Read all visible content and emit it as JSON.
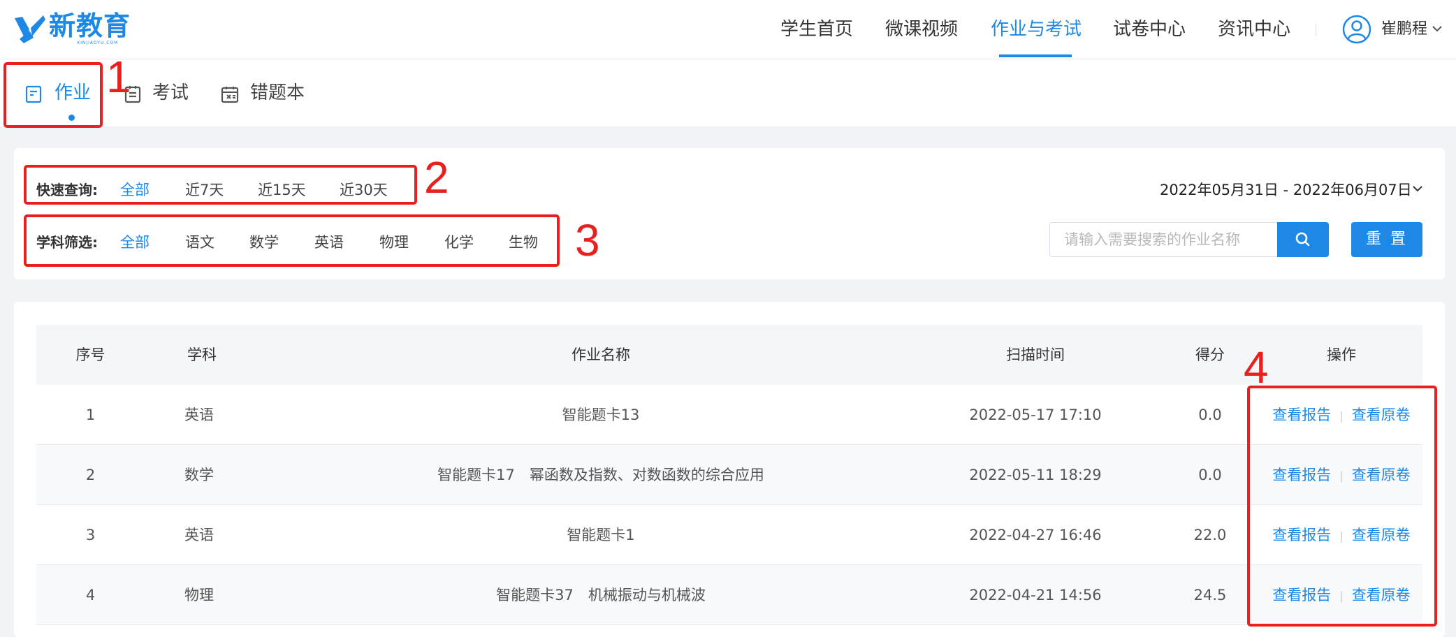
{
  "brand": {
    "name": "新教育",
    "subtitle": "XINJIAOYU.COM",
    "color": "#1e88e5"
  },
  "nav": {
    "items": [
      {
        "label": "学生首页",
        "active": false
      },
      {
        "label": "微课视频",
        "active": false
      },
      {
        "label": "作业与考试",
        "active": true
      },
      {
        "label": "试卷中心",
        "active": false
      },
      {
        "label": "资讯中心",
        "active": false
      }
    ],
    "user": {
      "name": "崔鹏程",
      "icon": "user-circle-icon"
    }
  },
  "subtabs": [
    {
      "label": "作业",
      "icon": "homework-icon",
      "active": true
    },
    {
      "label": "考试",
      "icon": "exam-icon",
      "active": false
    },
    {
      "label": "错题本",
      "icon": "mistake-book-icon",
      "active": false
    }
  ],
  "filters": {
    "quick": {
      "label": "快速查询:",
      "options": [
        "全部",
        "近7天",
        "近15天",
        "近30天"
      ],
      "selected": "全部"
    },
    "subject": {
      "label": "学科筛选:",
      "options": [
        "全部",
        "语文",
        "数学",
        "英语",
        "物理",
        "化学",
        "生物"
      ],
      "selected": "全部"
    },
    "date_range": "2022年05月31日 - 2022年06月07日",
    "search": {
      "placeholder": "请输入需要搜索的作业名称",
      "value": ""
    },
    "reset_label": "重 置"
  },
  "table": {
    "columns": [
      "序号",
      "学科",
      "作业名称",
      "扫描时间",
      "得分",
      "操作"
    ],
    "rows": [
      {
        "index": "1",
        "subject": "英语",
        "name": "智能题卡13",
        "time": "2022-05-17 17:10",
        "score": "0.0",
        "report": "查看报告",
        "paper": "查看原卷"
      },
      {
        "index": "2",
        "subject": "数学",
        "name": "智能题卡17　幂函数及指数、对数函数的综合应用",
        "time": "2022-05-11 18:29",
        "score": "0.0",
        "report": "查看报告",
        "paper": "查看原卷"
      },
      {
        "index": "3",
        "subject": "英语",
        "name": "智能题卡1",
        "time": "2022-04-27 16:46",
        "score": "22.0",
        "report": "查看报告",
        "paper": "查看原卷"
      },
      {
        "index": "4",
        "subject": "物理",
        "name": "智能题卡37　机械振动与机械波",
        "time": "2022-04-21 14:56",
        "score": "24.5",
        "report": "查看报告",
        "paper": "查看原卷"
      }
    ]
  },
  "annotations": {
    "labels": [
      "1",
      "2",
      "3",
      "4"
    ],
    "color": "#e8201f"
  }
}
